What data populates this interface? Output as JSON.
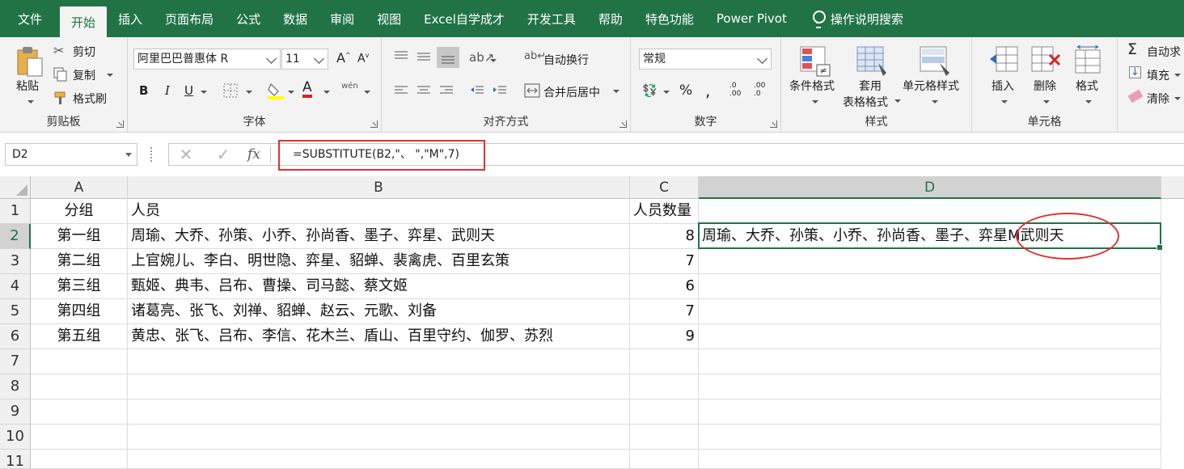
{
  "menu": {
    "tabs": [
      "文件",
      "开始",
      "插入",
      "页面布局",
      "公式",
      "数据",
      "审阅",
      "视图",
      "Excel自学成才",
      "开发工具",
      "帮助",
      "特色功能",
      "Power Pivot"
    ],
    "active_tab": "开始",
    "tell_me": "操作说明搜索"
  },
  "ribbon": {
    "clipboard": {
      "paste": "粘贴",
      "cut": "剪切",
      "copy": "复制",
      "format_painter": "格式刷",
      "label": "剪贴板"
    },
    "font": {
      "font_name": "阿里巴巴普惠体 R",
      "font_size": "11",
      "bold": "B",
      "italic": "I",
      "underline": "U",
      "phonetic": "wén",
      "label": "字体"
    },
    "alignment": {
      "wrap_text": "自动换行",
      "merge_center": "合并后居中",
      "label": "对齐方式"
    },
    "number": {
      "format": "常规",
      "percent": "%",
      "comma": ",",
      "inc_decimal": ".0 .00",
      "dec_decimal": ".00 .0",
      "label": "数字"
    },
    "styles": {
      "conditional": "条件格式",
      "table_format_1": "套用",
      "table_format_2": "表格格式",
      "cell_styles": "单元格样式",
      "label": "样式"
    },
    "cells": {
      "insert": "插入",
      "delete": "删除",
      "format": "格式",
      "label": "单元格"
    },
    "editing": {
      "autosum": "自动求",
      "fill": "填充",
      "clear": "清除"
    },
    "colors": {
      "accent": "#217346",
      "highlight": "#e03131"
    }
  },
  "formula_bar": {
    "name_box": "D2",
    "cancel": "✕",
    "enter": "✓",
    "fx": "fx",
    "formula": "=SUBSTITUTE(B2,\"、 \",\"M\",7)"
  },
  "sheet": {
    "columns": [
      "A",
      "B",
      "C",
      "D"
    ],
    "rows": [
      "1",
      "2",
      "3",
      "4",
      "5",
      "6",
      "7",
      "8",
      "9",
      "10",
      "11"
    ],
    "header": {
      "a": "分组",
      "b": "人员",
      "c": "人员数量",
      "d": ""
    },
    "data": [
      {
        "a": "第一组",
        "b": "周瑜、大乔、孙策、小乔、孙尚香、墨子、弈星、武则天",
        "c": "8",
        "d": "周瑜、大乔、孙策、小乔、孙尚香、墨子、弈星M武则天"
      },
      {
        "a": "第二组",
        "b": "上官婉儿、李白、明世隐、弈星、貂蝉、裴禽虎、百里玄策",
        "c": "7",
        "d": ""
      },
      {
        "a": "第三组",
        "b": "甄姬、典韦、吕布、曹操、司马懿、蔡文姬",
        "c": "6",
        "d": ""
      },
      {
        "a": "第四组",
        "b": "诸葛亮、张飞、刘禅、貂蝉、赵云、元歌、刘备",
        "c": "7",
        "d": ""
      },
      {
        "a": "第五组",
        "b": "黄忠、张飞、吕布、李信、花木兰、盾山、百里守约、伽罗、苏烈",
        "c": "9",
        "d": ""
      }
    ]
  }
}
